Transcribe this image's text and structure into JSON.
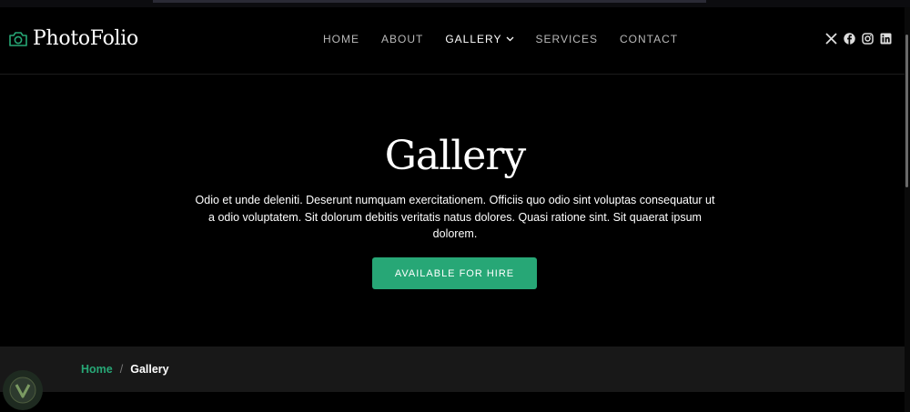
{
  "brand": {
    "name": "PhotoFolio",
    "icon": "camera-icon",
    "accent": "#27a776"
  },
  "nav": {
    "items": [
      {
        "label": "HOME"
      },
      {
        "label": "ABOUT"
      },
      {
        "label": "GALLERY",
        "active": true,
        "has_dropdown": true
      },
      {
        "label": "SERVICES"
      },
      {
        "label": "CONTACT"
      }
    ]
  },
  "social": [
    "x-icon",
    "facebook-icon",
    "instagram-icon",
    "linkedin-icon"
  ],
  "hero": {
    "title": "Gallery",
    "text": "Odio et unde deleniti. Deserunt numquam exercitationem. Officiis quo odio sint voluptas consequatur ut a odio voluptatem. Sit dolorum debitis veritatis natus dolores. Quasi ratione sint. Sit quaerat ipsum dolorem.",
    "button_label": "AVAILABLE FOR HIRE"
  },
  "breadcrumbs": {
    "home": "Home",
    "separator": "/",
    "current": "Gallery"
  }
}
